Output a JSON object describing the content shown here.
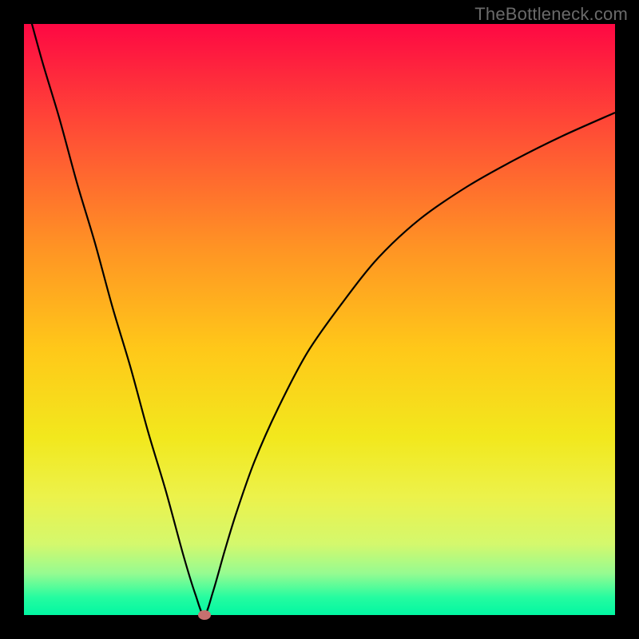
{
  "watermark": "TheBottleneck.com",
  "chart_data": {
    "type": "line",
    "title": "",
    "xlabel": "",
    "ylabel": "",
    "xlim": [
      0,
      100
    ],
    "ylim": [
      0,
      100
    ],
    "background": "gradient-red-yellow-green",
    "marker": {
      "x": 30.5,
      "y": 0,
      "color": "#c6706f"
    },
    "series": [
      {
        "name": "curve",
        "x": [
          0,
          3,
          6,
          9,
          12,
          15,
          18,
          21,
          24,
          27,
          29,
          30.5,
          32,
          34,
          36,
          39,
          43,
          48,
          54,
          60,
          67,
          75,
          83,
          91,
          100
        ],
        "y": [
          105,
          94,
          84,
          73,
          63,
          52,
          42,
          31,
          21,
          10,
          3.5,
          0,
          4,
          11,
          17.5,
          26,
          35,
          44.5,
          53,
          60.5,
          67,
          72.5,
          77,
          81,
          85
        ]
      }
    ]
  }
}
